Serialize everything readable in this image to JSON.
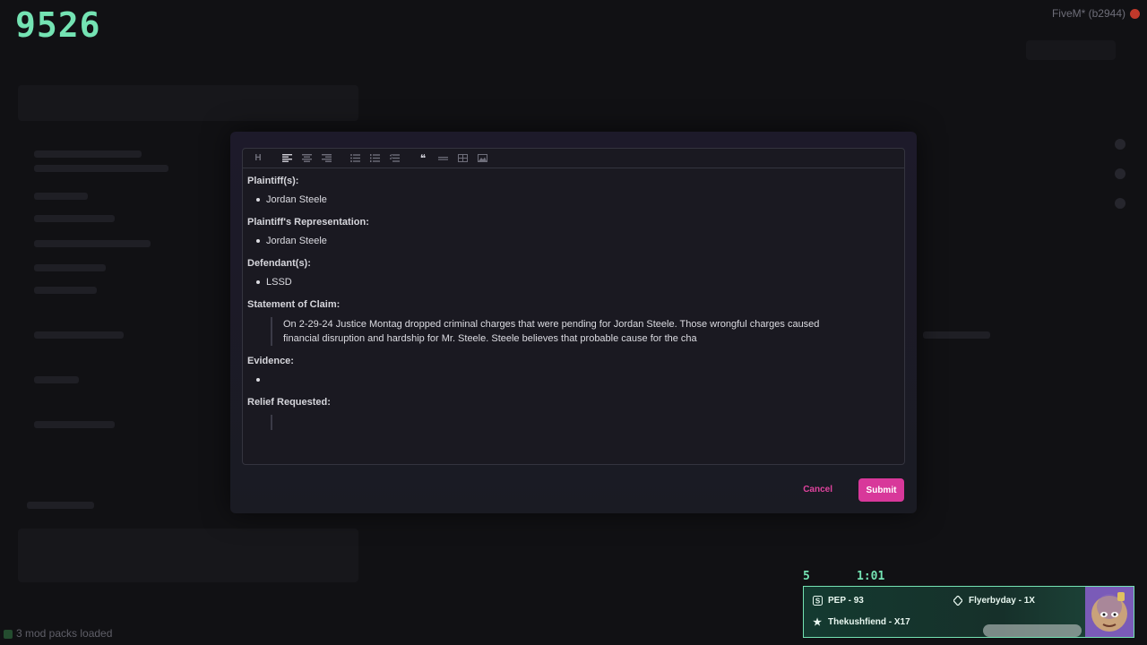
{
  "counter": "9526",
  "fivem_label": "FiveM* (b2944)",
  "mod_packs": "3 mod packs loaded",
  "toolbar": {
    "heading": "H",
    "quote": "❝"
  },
  "doc": {
    "plaintiffs_heading": "Plaintiff(s):",
    "plaintiffs": [
      "Jordan Steele"
    ],
    "representation_heading": "Plaintiff's Representation:",
    "representation": [
      "Jordan Steele"
    ],
    "defendants_heading": "Defendant(s):",
    "defendants": [
      "LSSD"
    ],
    "claim_heading": "Statement of Claim:",
    "claim_text": "On 2-29-24 Justice Montag dropped criminal charges that were pending for Jordan Steele. Those wrongful charges caused financial disruption and hardship for Mr. Steele. Steele believes that probable cause for the cha",
    "evidence_heading": "Evidence:",
    "evidence": [
      ""
    ],
    "relief_heading": "Relief Requested:"
  },
  "actions": {
    "cancel": "Cancel",
    "submit": "Submit"
  },
  "hud": {
    "left_number": "5",
    "timer": "1:01",
    "player1": "PEP - 93",
    "player2": "Flyerbyday - 1X",
    "player3": "Thekushfiend - X17"
  },
  "colors": {
    "accent": "#d8389a",
    "hud_green": "#74e3b3"
  }
}
